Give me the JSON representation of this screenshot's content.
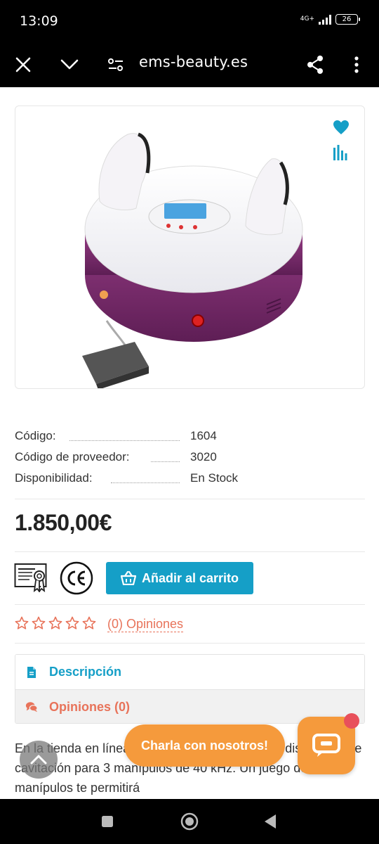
{
  "status_bar": {
    "time": "13:09",
    "network": "4G+",
    "battery": "26"
  },
  "browser": {
    "url": "ems-beauty.es",
    "icons": [
      "close-icon",
      "chevron-down-icon",
      "site-settings-icon",
      "share-icon",
      "more-vert-icon"
    ]
  },
  "product": {
    "icons": [
      "heart-icon",
      "compare-icon"
    ],
    "info": [
      {
        "label": "Código:",
        "value": "1604"
      },
      {
        "label": "Código de proveedor:",
        "value": "3020"
      },
      {
        "label": "Disponibilidad:",
        "value": "En Stock"
      }
    ],
    "price": "1.850,00€",
    "add_to_cart": "Añadir al carrito",
    "rating": 0,
    "reviews_link": "(0) Opiniones",
    "colors": {
      "accent": "#159fc7",
      "orange": "#e8735a",
      "chat": "#f59a3c"
    }
  },
  "tabs": {
    "description": "Descripción",
    "reviews": "Opiniones (0)"
  },
  "description_text": "En la tienda en línea ponemos a su atención un dispositivo de cavitación para 3 manípulos de 40 kHz. Un juego de varios manípulos te permitirá",
  "chat": {
    "bubble": "Charla con nosotros!"
  },
  "nav": {
    "icons": [
      "recents-icon",
      "home-icon",
      "back-icon"
    ]
  }
}
